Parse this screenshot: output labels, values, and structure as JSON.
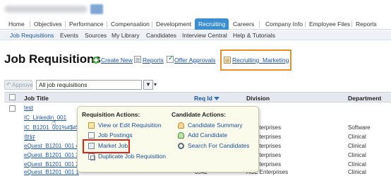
{
  "topnav": {
    "items": [
      "Home",
      "Objectives",
      "Performance",
      "Compensation",
      "Development",
      "Recruiting",
      "Careers",
      "Company Info",
      "Employee Files",
      "Reports"
    ],
    "active": "Recruiting"
  },
  "subnav": {
    "items": [
      "Job Requisitions",
      "Events",
      "Sources",
      "My Library",
      "Candidates",
      "Interview Central",
      "Help & Tutorials"
    ],
    "active": "Job Requisitions"
  },
  "page": {
    "title": "Job Requisitions",
    "actions": {
      "create_new": "Create New",
      "reports": "Reports",
      "offer_approvals": "Offer Approvals",
      "recruiting_marketing": "Recruiting_Marketing"
    }
  },
  "toolbar": {
    "approve_label": "Approve",
    "filter_value": "All job requisitions",
    "filter_button": "▼",
    "dropdown_glyph": "▾"
  },
  "table": {
    "headers": {
      "job_title": "Job Title",
      "req_id": "Req Id",
      "division": "Division",
      "department": "Department"
    },
    "rows": [
      {
        "title": "test",
        "req_id": "",
        "division": "",
        "department": ""
      },
      {
        "title": "IC_Linkedin_001",
        "req_id": "",
        "division": "",
        "department": ""
      },
      {
        "title": "IC_B1201_001%#$#$",
        "req_id": "",
        "division": "nterprises",
        "department": "Software"
      },
      {
        "title": "您好",
        "req_id": "",
        "division": "nterprises",
        "department": "Clinical"
      },
      {
        "title": "eQuest_B1201_001 4",
        "req_id": "",
        "division": "nterprises",
        "department": "Clinical"
      },
      {
        "title": "eQuest_B1201_001 3",
        "req_id": "",
        "division": "nterprises",
        "department": "Clinical"
      },
      {
        "title": "eQuest_B1201_001 2",
        "req_id": "",
        "division": "nterprises",
        "department": "Clinical"
      },
      {
        "title": "eQuest_B1201_001 1",
        "req_id": "3542",
        "division": "ACE Enterprises",
        "department": "Clinical"
      }
    ]
  },
  "popup": {
    "requisition_heading": "Requisition Actions:",
    "requisition_items": [
      "View or Edit Requisition",
      "Job Postings",
      "Market Job",
      "Duplicate Job Requisition"
    ],
    "candidate_heading": "Candidate Actions:",
    "candidate_items": [
      "Candidate Summary",
      "Add Candidate",
      "Search For Candidates"
    ]
  },
  "colors": {
    "accent": "#3b8ed0",
    "link": "#1a56a3",
    "highlight_orange": "#f28c28",
    "highlight_red": "#e0231b",
    "popup_bg": "#fafbea"
  },
  "icons": {
    "create_new": "plus-circle-icon",
    "reports": "report-icon",
    "offer_approvals": "checklist-icon",
    "recruiting_marketing": "document-icon",
    "cursor": "hand-pointer-icon"
  }
}
